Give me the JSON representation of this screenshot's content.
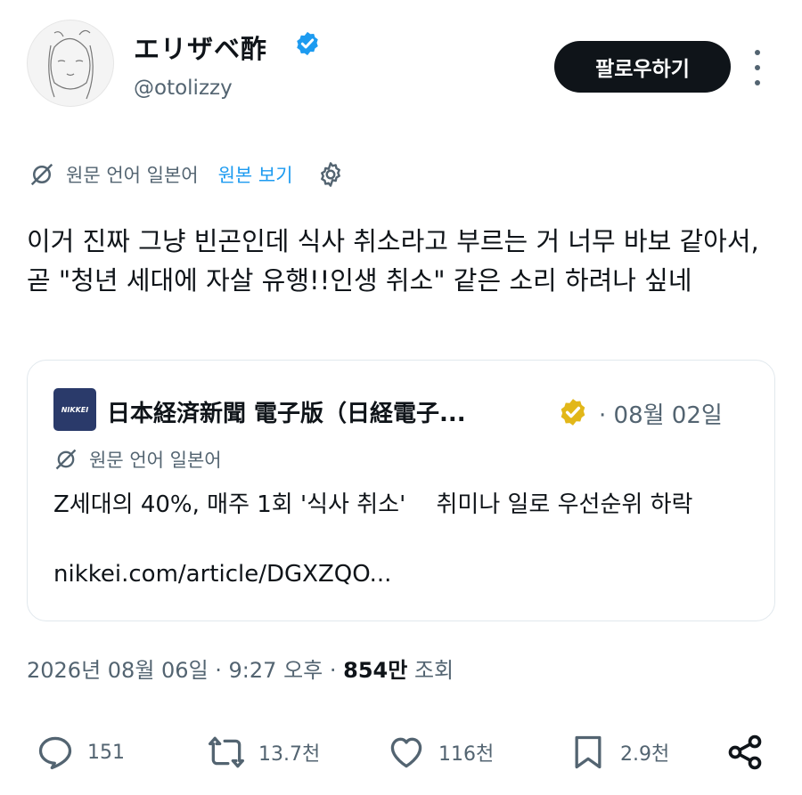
{
  "author": {
    "name": "エリザベ酢",
    "handle": "@otolizzy",
    "verified": true
  },
  "follow_button": {
    "label": "팔로우하기"
  },
  "more_icon": "more-vertical-icon",
  "translation_bar": {
    "original_language": "원문 언어 일본어",
    "view_original": "원본 보기"
  },
  "tweet_text": "이거 진짜 그냥 빈곤인데 식사 취소라고 부르는 거 너무 바보 같아서, 곧 \"청년 세대에 자살 유행!!인생 취소\" 같은 소리 하려나 싶네",
  "quoted_card": {
    "logo_text": "NIKKEI",
    "source_name": "日本経済新聞 電子版（日経電子...",
    "date": "· 08월 02일",
    "translation_label": "원문 언어 일본어",
    "headline": "Z세대의 40%, 매주 1회 '식사 취소'　 취미나 일로 우선순위 하락",
    "link": "nikkei.com/article/DGXZQO..."
  },
  "meta": {
    "timestamp": "2026년 08월 06일 · 9:27 오후 · ",
    "views_count": "854만",
    "views_label": " 조회"
  },
  "actions": {
    "replies": "151",
    "reposts": "13.7천",
    "likes": "116천",
    "bookmarks": "2.9천"
  },
  "colors": {
    "text": "#0f1419",
    "secondary": "#536471",
    "accent": "#1d9bf0",
    "gold": "#e2b719"
  }
}
